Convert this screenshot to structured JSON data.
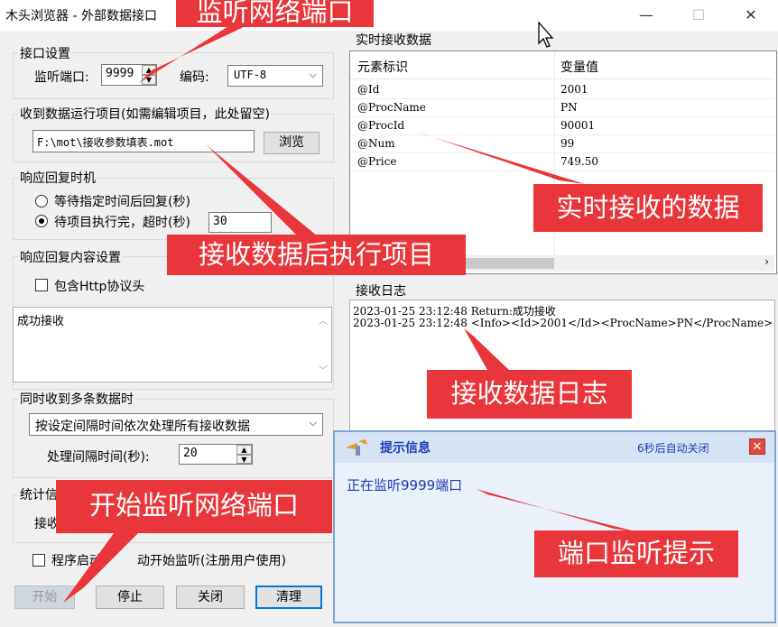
{
  "window": {
    "title": "木头浏览器 - 外部数据接口",
    "minimize": "—",
    "maximize": "☐",
    "close": "✕"
  },
  "port_settings": {
    "group_label": "接口设置",
    "port_label": "监听端口:",
    "port_value": "9999",
    "encoding_label": "编码:",
    "encoding_value": "UTF-8"
  },
  "project": {
    "group_label": "收到数据运行项目(如需编辑项目，此处留空)",
    "path_value": "F:\\mot\\接收参数填表.mot",
    "browse_label": "浏览"
  },
  "response_timing": {
    "group_label": "响应回复时机",
    "option_wait": "等待指定时间后回复(秒)",
    "option_after": "待项目执行完，超时(秒)",
    "timeout_value": "30",
    "selected": "option_after"
  },
  "response_content": {
    "group_label": "响应回复内容设置",
    "http_label": "包含Http协议头",
    "http_checked": false,
    "content_value": "成功接收"
  },
  "multi_data": {
    "group_label": "同时收到多条数据时",
    "mode_value": "按设定间隔时间依次处理所有接收数据",
    "interval_label": "处理间隔时间(秒):",
    "interval_value": "20"
  },
  "stats": {
    "group_label_partial": "统计信",
    "receive_label_partial": "接收"
  },
  "autostart": {
    "label_left": "程序启动",
    "label_right": "动开始监听(注册用户使用)",
    "checked": false
  },
  "buttons": {
    "start": "开始",
    "stop": "停止",
    "close": "关闭",
    "clear": "清理"
  },
  "realtime": {
    "group_label": "实时接收数据",
    "columns": [
      "元素标识",
      "变量值"
    ],
    "rows": [
      [
        "@Id",
        "2001"
      ],
      [
        "@ProcName",
        "PN"
      ],
      [
        "@ProcId",
        "90001"
      ],
      [
        "@Num",
        "99"
      ],
      [
        "@Price",
        "749.50"
      ]
    ]
  },
  "log": {
    "group_label": "接收日志",
    "lines": [
      "2023-01-25 23:12:48 Return:成功接收",
      "2023-01-25 23:12:48 <Info><Id>2001</Id><ProcName>PN</ProcName>"
    ]
  },
  "popup": {
    "title": "提示信息",
    "countdown": "6秒后自动关闭",
    "close": "✕",
    "message": "正在监听9999端口"
  },
  "callouts": {
    "listen_port": "监听网络端口",
    "realtime_data": "实时接收的数据",
    "run_project": "接收数据后执行项目",
    "log": "接收数据日志",
    "start_listen": "开始监听网络端口",
    "port_tip": "端口监听提示"
  },
  "colors": {
    "callout": "#e8363a",
    "popup_text": "#1a3db5",
    "focus": "#0078d7"
  }
}
